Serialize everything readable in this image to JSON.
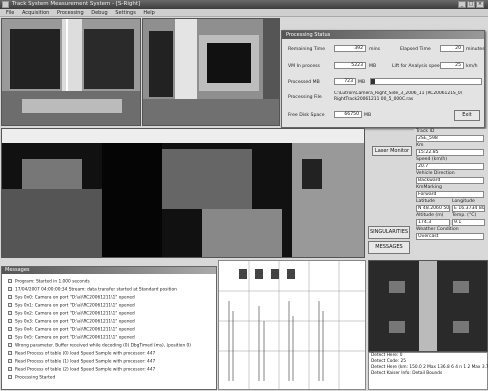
{
  "window": {
    "title": "Track System Measurement System - [S-Right]"
  },
  "menu": [
    "File",
    "Acquisition",
    "Processing",
    "Debug",
    "Settings",
    "Help"
  ],
  "dialog": {
    "title": "Processing Status",
    "remaining_time_label": "Remaining Time",
    "remaining_time_value": "392",
    "remaining_time_unit": "mins",
    "elapsed_time_label": "Elapsed Time",
    "elapsed_time_value": "20",
    "elapsed_time_unit": "minutes",
    "vm_in_process_label": "VM In process",
    "vm_in_process_value": "5223",
    "vm_in_process_unit": "MB",
    "upload_speed_label": "Lift for Analysis speed",
    "upload_speed_value": "25",
    "upload_speed_unit": "km/h",
    "processed_label": "Processed MB",
    "processed_value": "723",
    "processed_unit": "MB",
    "processing_file_label": "Processing File",
    "processing_file_value": "C:\\Lutron\\Camera_Right_Side_3_2006_11 [RC2006121S_0\\ RightTrack20061211 00_5_000C.ras",
    "free_disk_label": "Free Disk Space",
    "free_disk_value": "66750",
    "free_disk_unit": "MB",
    "exit_button": "Exit"
  },
  "buttons": {
    "laser_monitor": "Laser Monitor",
    "singularities": "SINGULARITIES",
    "messages": "MESSAGES"
  },
  "info": {
    "track_id_label": "Track ID",
    "track_id": "2SE_598",
    "km_label": "Km",
    "km": "15:22.85",
    "speed_label": "Speed (km/h)",
    "speed": "20.7",
    "vehicle_direction_label": "Vehicle Direction",
    "vehicle_direction": "Backward",
    "km_mark_label": "KmMarking",
    "km_mark": "Forward",
    "latitude_label": "Latitude",
    "latitude": "N 48.2060 50",
    "longitude_label": "Longitude",
    "longitude": "E 16.3734 80",
    "altitude_label": "Altitude (m)",
    "altitude": "174.3",
    "temp_label": "Temp. (°C)",
    "temp": "9.1",
    "weather_label": "Weather Condition",
    "weather": "Overcast"
  },
  "messages": {
    "title": "Messages",
    "items": [
      "Program: Started in 1.000 seconds",
      "17/04/2007 04:00:00:34 Stream: data transfer started at Standard position",
      "Sys 0x0: Camera on port \"D:\\a\\\\RC20061211\\1\" opened",
      "Sys 0x1: Camera on port \"D:\\a\\\\RC20061211\\1\" opened",
      "Sys 0x2: Camera on port \"D:\\a\\\\RC20061211\\1\" opened",
      "Sys 0x3: Camera on port \"D:\\a\\\\RC20061211\\1\" opened",
      "Sys 0x4: Camera on port \"D:\\a\\\\RC20061211\\1\" opened",
      "Sys 0x5: Camera on port \"D:\\a\\\\RC20061211\\1\" opened",
      "Wrong parameter. Buffer received while decoding (0) DbgTimed (ms), (position 0)",
      "Read Process of table (0) load Speed Sample with processor: 447",
      "Read Process of table (1) load Speed Sample with processor: 447",
      "Read Process of table (2) load Speed Sample with processor: 447",
      "Processing Started"
    ]
  },
  "status": {
    "lines": [
      "Detect Here: 0",
      "Detect Code: 25",
      "Detect Here (km: 150.0 2 Max 136.8 6 4 n 1 2 Max 3.7",
      "Detect Kaiser Info: Detail Bounds"
    ]
  },
  "colors": {
    "titlebar": "#4a4a4a",
    "panel": "#d9d9d9"
  }
}
